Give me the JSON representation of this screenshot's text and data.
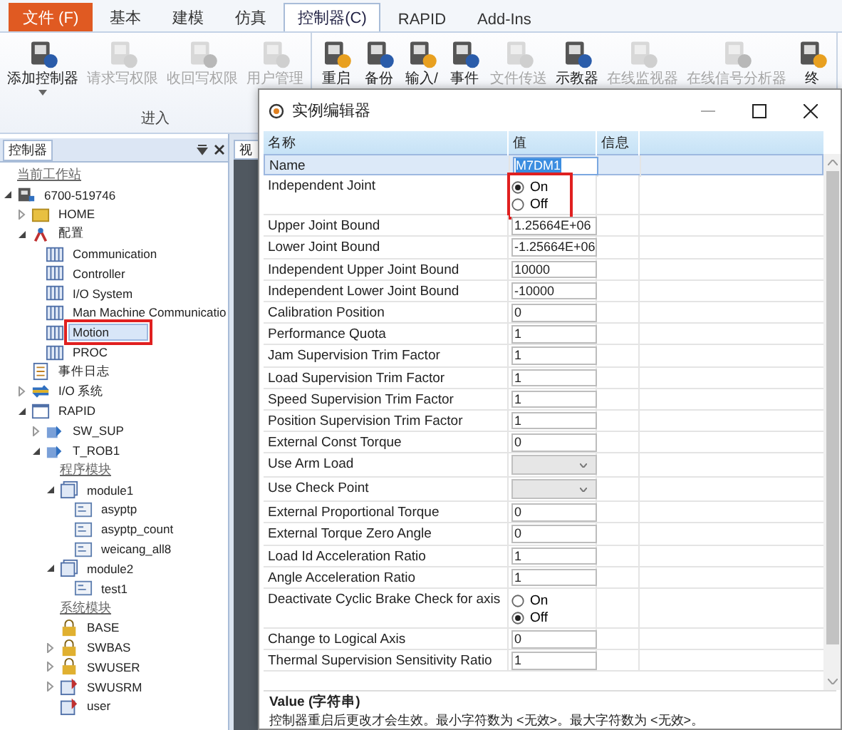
{
  "menu_tabs": [
    {
      "label": "文件 (F)",
      "kind": "file",
      "selected": false
    },
    {
      "label": "基本",
      "kind": "tab",
      "selected": false
    },
    {
      "label": "建模",
      "kind": "tab",
      "selected": false
    },
    {
      "label": "仿真",
      "kind": "tab",
      "selected": false
    },
    {
      "label": "控制器(C)",
      "kind": "tab",
      "selected": true
    },
    {
      "label": "RAPID",
      "kind": "tab",
      "selected": false
    },
    {
      "label": "Add-Ins",
      "kind": "tab",
      "selected": false
    }
  ],
  "ribbon_groups": [
    {
      "label": "进入",
      "buttons": [
        {
          "label": "添加控制器",
          "disabled": false,
          "dropdown": true
        },
        {
          "label": "请求写权限",
          "disabled": true
        },
        {
          "label": "收回写权限",
          "disabled": true
        },
        {
          "label": "用户管理",
          "disabled": true
        }
      ]
    },
    {
      "buttons": [
        {
          "label": "重启",
          "disabled": false
        },
        {
          "label": "备份",
          "disabled": false
        },
        {
          "label": "输入/",
          "disabled": false
        },
        {
          "label": "事件",
          "disabled": false
        },
        {
          "label": "文件传送",
          "disabled": true
        },
        {
          "label": "示教器",
          "disabled": false
        },
        {
          "label": "在线监视器",
          "disabled": true
        },
        {
          "label": "在线信号分析器",
          "disabled": true
        },
        {
          "label": "终",
          "disabled": false
        }
      ]
    }
  ],
  "controller_panel": {
    "title": "控制器",
    "tree": [
      {
        "label": "当前工作站",
        "kind": "section"
      },
      {
        "label": "6700-519746",
        "kind": "controller",
        "selected": false,
        "expanded": true,
        "children": [
          {
            "label": "HOME",
            "kind": "folder",
            "selected": false,
            "expanded": false
          },
          {
            "label": "配置",
            "kind": "config",
            "selected": false,
            "expanded": true,
            "children": [
              {
                "label": "Communication",
                "kind": "table",
                "selected": false
              },
              {
                "label": "Controller",
                "kind": "table",
                "selected": false
              },
              {
                "label": "I/O System",
                "kind": "table",
                "selected": false
              },
              {
                "label": "Man Machine Communicatio",
                "kind": "table",
                "selected": false
              },
              {
                "label": "Motion",
                "kind": "table",
                "selected": true,
                "annotated": true
              },
              {
                "label": "PROC",
                "kind": "table",
                "selected": false
              }
            ]
          },
          {
            "label": "事件日志",
            "kind": "log",
            "selected": false
          },
          {
            "label": "I/O 系统",
            "kind": "io",
            "selected": false,
            "expanded": false
          },
          {
            "label": "RAPID",
            "kind": "rapid",
            "selected": false,
            "expanded": true,
            "children": [
              {
                "label": "SW_SUP",
                "kind": "task",
                "selected": false,
                "expanded": false
              },
              {
                "label": "T_ROB1",
                "kind": "task",
                "selected": false,
                "expanded": true,
                "children": [
                  {
                    "label": "程序模块",
                    "kind": "section"
                  },
                  {
                    "label": "module1",
                    "kind": "module",
                    "selected": false,
                    "expanded": true,
                    "children": [
                      {
                        "label": "asyptp",
                        "kind": "routine",
                        "selected": false
                      },
                      {
                        "label": "asyptp_count",
                        "kind": "routine",
                        "selected": false
                      },
                      {
                        "label": "weicang_all8",
                        "kind": "routine",
                        "selected": false
                      }
                    ]
                  },
                  {
                    "label": "module2",
                    "kind": "module",
                    "selected": false,
                    "expanded": true,
                    "children": [
                      {
                        "label": "test1",
                        "kind": "routine",
                        "selected": false
                      }
                    ]
                  },
                  {
                    "label": "系统模块",
                    "kind": "section"
                  },
                  {
                    "label": "BASE",
                    "kind": "lock",
                    "selected": false
                  },
                  {
                    "label": "SWBAS",
                    "kind": "lock",
                    "selected": false,
                    "expanded": false
                  },
                  {
                    "label": "SWUSER",
                    "kind": "lock",
                    "selected": false,
                    "expanded": false
                  },
                  {
                    "label": "SWUSRM",
                    "kind": "sysmodule",
                    "selected": false,
                    "expanded": false
                  },
                  {
                    "label": "user",
                    "kind": "sysmodule",
                    "selected": false
                  }
                ]
              }
            ]
          }
        ]
      }
    ]
  },
  "view_tab": {
    "label": "视"
  },
  "dialog": {
    "title": "实例编辑器",
    "columns": [
      "名称",
      "值",
      "信息"
    ],
    "rows": [
      {
        "name": "Name",
        "kind": "text",
        "value": "M7DM1",
        "selected": true
      },
      {
        "name": "Independent Joint",
        "kind": "radio",
        "selected": false,
        "annotated": true,
        "options": [
          {
            "label": "On",
            "selected": true
          },
          {
            "label": "Off",
            "selected": false
          }
        ]
      },
      {
        "name": "Upper Joint Bound",
        "kind": "text",
        "value": "1.25664E+06",
        "selected": false
      },
      {
        "name": "Lower Joint Bound",
        "kind": "text",
        "value": "-1.25664E+06",
        "selected": false
      },
      {
        "name": "Independent Upper Joint Bound",
        "kind": "text",
        "value": "10000",
        "selected": false
      },
      {
        "name": "Independent Lower Joint Bound",
        "kind": "text",
        "value": "-10000",
        "selected": false
      },
      {
        "name": "Calibration Position",
        "kind": "text",
        "value": "0",
        "selected": false
      },
      {
        "name": "Performance Quota",
        "kind": "text",
        "value": "1",
        "selected": false
      },
      {
        "name": "Jam Supervision Trim Factor",
        "kind": "text",
        "value": "1",
        "selected": false
      },
      {
        "name": "Load Supervision Trim Factor",
        "kind": "text",
        "value": "1",
        "selected": false
      },
      {
        "name": "Speed Supervision Trim Factor",
        "kind": "text",
        "value": "1",
        "selected": false
      },
      {
        "name": "Position Supervision Trim Factor",
        "kind": "text",
        "value": "1",
        "selected": false
      },
      {
        "name": "External Const Torque",
        "kind": "text",
        "value": "0",
        "selected": false
      },
      {
        "name": "Use Arm Load",
        "kind": "dropdown",
        "selected": false
      },
      {
        "name": "Use Check Point",
        "kind": "dropdown",
        "selected": false
      },
      {
        "name": "External Proportional Torque",
        "kind": "text",
        "value": "0",
        "selected": false
      },
      {
        "name": "External Torque Zero Angle",
        "kind": "text",
        "value": "0",
        "selected": false
      },
      {
        "name": "Load Id Acceleration Ratio",
        "kind": "text",
        "value": "1",
        "selected": false
      },
      {
        "name": "Angle Acceleration Ratio",
        "kind": "text",
        "value": "1",
        "selected": false
      },
      {
        "name": "Deactivate Cyclic Brake Check for axis",
        "kind": "radio",
        "selected": false,
        "options": [
          {
            "label": "On",
            "selected": false
          },
          {
            "label": "Off",
            "selected": true
          }
        ]
      },
      {
        "name": "Change to Logical Axis",
        "kind": "text",
        "value": "0",
        "selected": false
      },
      {
        "name": "Thermal Supervision Sensitivity Ratio",
        "kind": "text",
        "value": "1",
        "selected": false
      }
    ],
    "description": {
      "title": "Value (字符串)",
      "text": "控制器重启后更改才会生效。最小字符数为 <无效>。最大字符数为 <无效>。"
    }
  }
}
